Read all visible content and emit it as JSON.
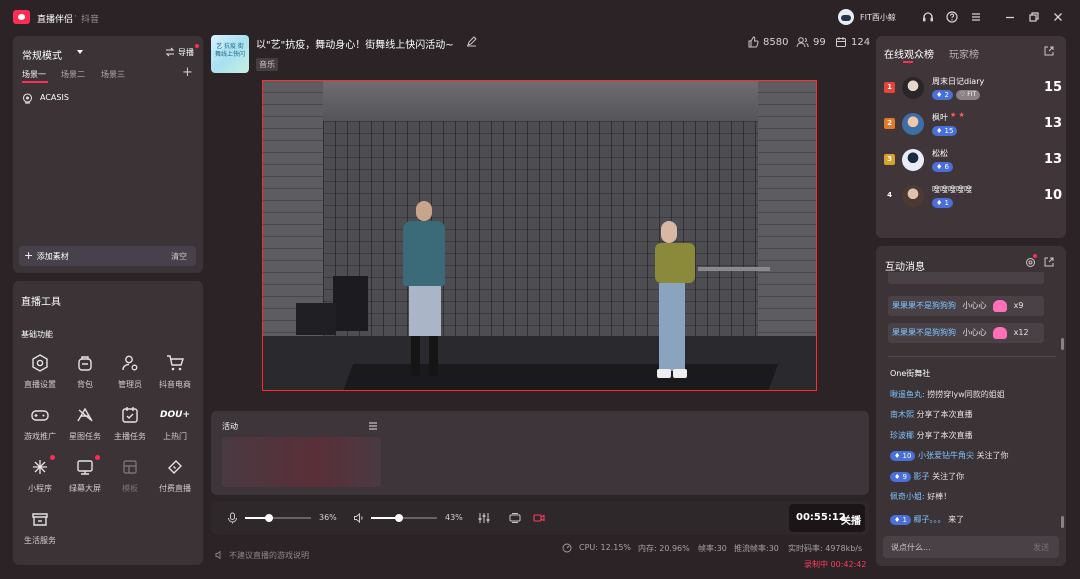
{
  "titlebar": {
    "app_name": "直播伴侣",
    "sep": "·",
    "platform": "抖音",
    "username": "FIT酉小鲸"
  },
  "left": {
    "mode_label": "常规模式",
    "guide_label": "导播",
    "scenes": [
      "场景一",
      "场景二",
      "场景三"
    ],
    "source_item": "ACASIS",
    "add_material": "添加素材",
    "clear": "清空",
    "tools_title": "直播工具",
    "basic_title": "基础功能",
    "tools": [
      {
        "label": "直播设置",
        "icon": "hexagon-settings-icon"
      },
      {
        "label": "背包",
        "icon": "backpack-icon"
      },
      {
        "label": "管理员",
        "icon": "admin-user-icon"
      },
      {
        "label": "抖音电商",
        "icon": "shopping-cart-icon"
      },
      {
        "label": "游戏推广",
        "icon": "gamepad-icon"
      },
      {
        "label": "星图任务",
        "icon": "star-map-icon"
      },
      {
        "label": "主播任务",
        "icon": "task-calendar-icon"
      },
      {
        "label": "上热门",
        "icon": "dou-plus-icon"
      },
      {
        "label": "小程序",
        "icon": "mini-program-icon"
      },
      {
        "label": "绿幕大屏",
        "icon": "green-screen-icon"
      },
      {
        "label": "模板",
        "icon": "template-icon"
      },
      {
        "label": "付费直播",
        "icon": "paid-ticket-icon"
      },
      {
        "label": "生活服务",
        "icon": "life-service-icon"
      }
    ],
    "dou_text": "DOU+"
  },
  "header": {
    "thumb_text": "艺 抗疫 街舞线上快闪",
    "title": "以\"艺\"抗疫，舞动身心！街舞线上快闪活动~",
    "tag": "音乐",
    "likes": "8580",
    "viewers": "99",
    "count3": "124"
  },
  "activity": {
    "label": "活动"
  },
  "audio": {
    "mic_percent": "36%",
    "mic_level": 0.36,
    "speaker_percent": "43%",
    "speaker_level": 0.43
  },
  "live": {
    "timer": "00:55:12",
    "close_label": "关播"
  },
  "status": {
    "hint": "不建议直播的游戏说明",
    "cpu": "CPU: 12.15%",
    "mem": "内存: 20.96%",
    "fps": "帧率:30",
    "push_fps": "推流帧率:30",
    "bitrate": "实时码率: 4978kb/s",
    "recording": "录制中 00:42:42"
  },
  "rank": {
    "tab_active": "在线观众榜",
    "tab_other": "玩家榜",
    "rows": [
      {
        "rank": "1",
        "name": "周末日记diary",
        "level": "2",
        "badge": "FIT",
        "score": "15",
        "color": "#e5443a"
      },
      {
        "rank": "2",
        "name": "枫叶",
        "level": "15",
        "badge": "",
        "score": "13",
        "color": "#e07a2a"
      },
      {
        "rank": "3",
        "name": "松松",
        "level": "6",
        "badge": "",
        "score": "13",
        "color": "#d6a22a"
      },
      {
        "rank": "4",
        "name": "嗖嗖嗖嗖嗖",
        "level": "1",
        "badge": "",
        "score": "10",
        "color": ""
      }
    ]
  },
  "chat": {
    "title": "互动消息",
    "gifts": [
      {
        "user": "果果果不是狗狗狗",
        "gift": "小心心",
        "count": "x9"
      },
      {
        "user": "果果果不是狗狗狗",
        "gift": "小心心",
        "count": "x12"
      }
    ],
    "messages": [
      {
        "user": "One街舞社",
        "text": "",
        "level": ""
      },
      {
        "user": "啾遥鱼丸:",
        "text": "捞捞穿lyw同款的姐姐",
        "level": ""
      },
      {
        "user": "南木熙",
        "text": "分享了本次直播",
        "level": ""
      },
      {
        "user": "珍波椰",
        "text": "分享了本次直播",
        "level": ""
      },
      {
        "user": "小张爱钻牛角尖",
        "text": "关注了你",
        "level": "10"
      },
      {
        "user": "影子",
        "text": "关注了你",
        "level": "9"
      },
      {
        "user": "佩奇小姐:",
        "text": "好棒！",
        "level": ""
      },
      {
        "user": "椰子。。。",
        "text": "来了",
        "level": "1"
      }
    ],
    "input_placeholder": "说点什么...",
    "send": "发送"
  },
  "colors": {
    "accent": "#ff2d55",
    "panel": "#3b3336",
    "bg": "#2b2325",
    "preview_border": "#ff2a2a",
    "level_badge": "#4a6fd8"
  }
}
